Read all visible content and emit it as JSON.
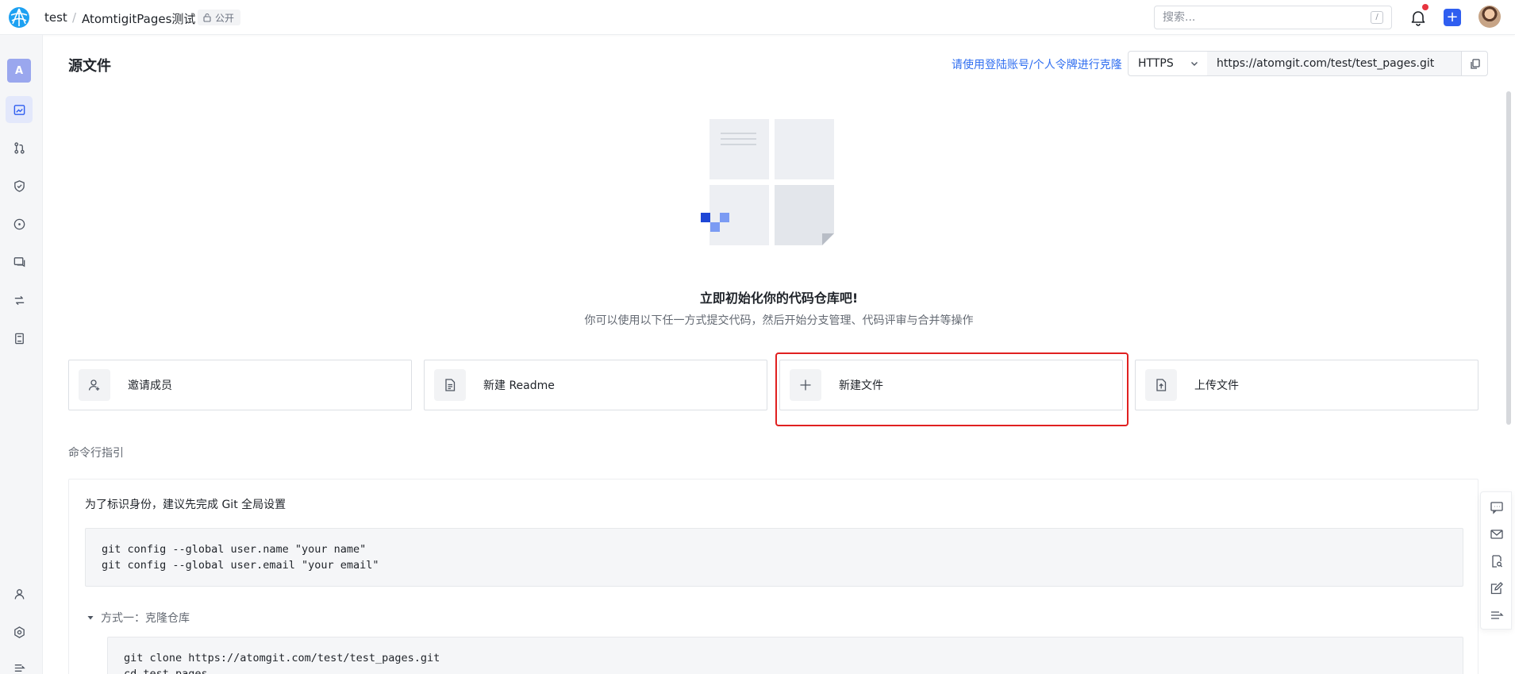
{
  "header": {
    "owner": "test",
    "separator": "/",
    "repo_name": "AtomtigitPages测试",
    "visibility": "公开",
    "search_placeholder": "搜索...",
    "search_shortcut": "/",
    "plus_label": "+"
  },
  "sidebar": {
    "project_avatar_letter": "A",
    "items": [
      {
        "icon": "repo-home-icon",
        "active": true
      },
      {
        "icon": "merge-request-icon",
        "active": false
      },
      {
        "icon": "security-shield-icon",
        "active": false
      },
      {
        "icon": "issues-icon",
        "active": false
      },
      {
        "icon": "discussion-icon",
        "active": false
      },
      {
        "icon": "pipeline-icon",
        "active": false
      },
      {
        "icon": "wiki-book-icon",
        "active": false
      },
      {
        "icon": "member-icon",
        "active": false
      },
      {
        "icon": "settings-icon",
        "active": false
      },
      {
        "icon": "collapse-icon",
        "active": false
      }
    ]
  },
  "main": {
    "title": "源文件",
    "clone_hint": "请使用登陆账号/个人令牌进行克隆",
    "protocol": "HTTPS",
    "clone_url": "https://atomgit.com/test/test_pages.git",
    "empty_title": "立即初始化你的代码仓库吧!",
    "empty_subtitle": "你可以使用以下任一方式提交代码，然后开始分支管理、代码评审与合并等操作",
    "actions": [
      {
        "label": "邀请成员",
        "icon": "invite-member-icon"
      },
      {
        "label": "新建 Readme",
        "icon": "readme-file-icon"
      },
      {
        "label": "新建文件",
        "icon": "plus-icon"
      },
      {
        "label": "上传文件",
        "icon": "upload-file-icon"
      }
    ],
    "cli_title": "命令行指引",
    "cli_intro": "为了标识身份，建议先完成 Git 全局设置",
    "git_config_code": "git config --global user.name \"your name\"\ngit config --global user.email \"your email\"",
    "method_one_label": "方式一：克隆仓库",
    "clone_code": "git clone https://atomgit.com/test/test_pages.git\ncd test_pages"
  },
  "colors": {
    "accent": "#2f5ef0",
    "link": "#2f6ef0",
    "highlight": "#e02020",
    "notification": "#e7343f"
  }
}
